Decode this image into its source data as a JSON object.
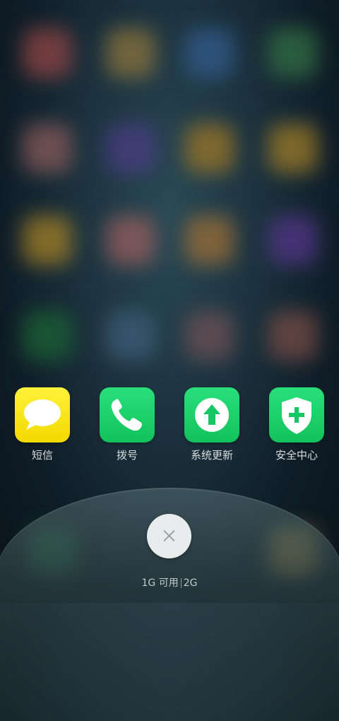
{
  "apps": [
    {
      "label": "短信",
      "icon": "message-bubble-icon",
      "color": "#f7e600"
    },
    {
      "label": "拨号",
      "icon": "phone-icon",
      "color": "#1ed36b"
    },
    {
      "label": "系统更新",
      "icon": "upload-arrow-icon",
      "color": "#1ed36b"
    },
    {
      "label": "安全中心",
      "icon": "shield-plus-icon",
      "color": "#1ed36b"
    }
  ],
  "memory": {
    "available": "1G 可用",
    "total": "2G"
  },
  "colors": {
    "accent_green": "#1ed36b",
    "message_yellow": "#f7e600"
  }
}
